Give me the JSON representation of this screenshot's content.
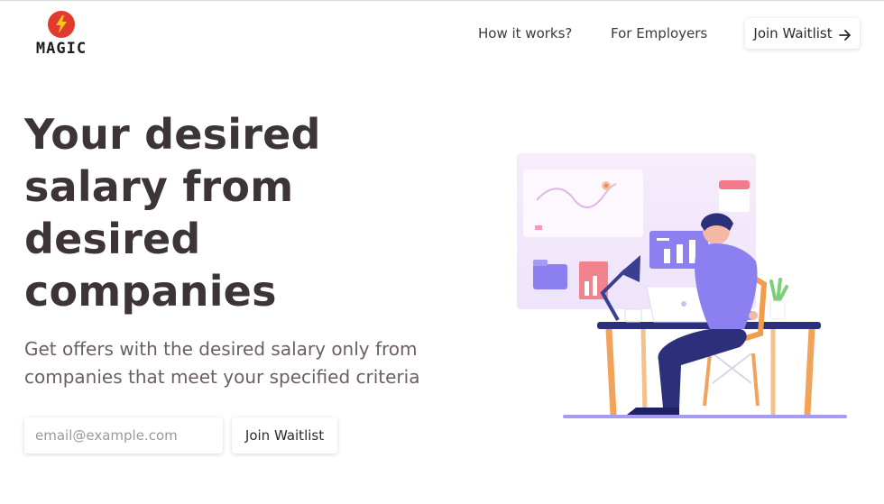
{
  "header": {
    "logo_text": "MAGIC",
    "nav": {
      "how_it_works": "How it works?",
      "for_employers": "For Employers"
    },
    "cta_label": "Join Waitlist"
  },
  "hero": {
    "title": "Your desired salary from desired companies",
    "subtitle": "Get offers with the desired salary only from companies that meet your specified criteria",
    "email_placeholder": "email@example.com",
    "join_label": "Join Waitlist"
  },
  "icons": {
    "logo": "lightning-bolt-icon",
    "cta_arrow": "arrow-right-icon"
  },
  "colors": {
    "brand_red": "#e23a2e",
    "text_dark": "#3d3535",
    "text_muted": "#6b5f5f",
    "accent_purple": "#8c7ff0",
    "accent_orange": "#f29d4b"
  }
}
